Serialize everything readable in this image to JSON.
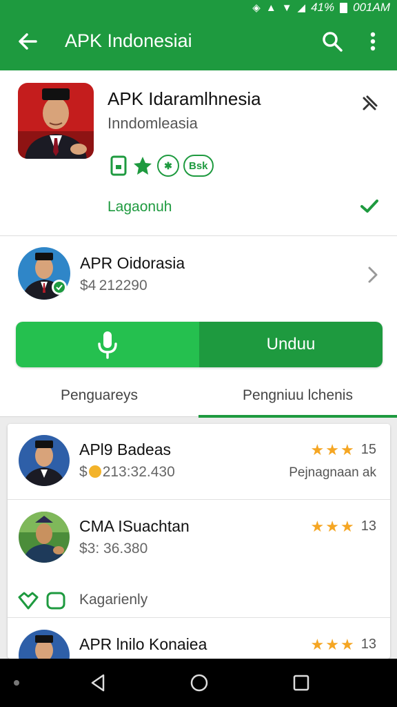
{
  "status_bar": {
    "battery_text": "41%",
    "time": "001AM"
  },
  "app_bar": {
    "title": "APK Indonesiai",
    "back_icon": "arrow-left-icon",
    "search_icon": "search-icon",
    "more_icon": "more-vert-icon"
  },
  "app_header": {
    "name": "APK Idaramlhnesia",
    "developer": "Inndomleasia",
    "badge_label": "Bsk",
    "status_label": "Lagaonuh"
  },
  "developer_row": {
    "name": "APR Oidorasia",
    "price": "$4 212290"
  },
  "action": {
    "download_label": "Unduu"
  },
  "tabs": [
    {
      "label": "Penguareys"
    },
    {
      "label": "Pengniuu lchenis"
    }
  ],
  "list": [
    {
      "title": "APl9 Badeas",
      "price": "213:32.430",
      "rating": 3,
      "count": "15",
      "subtitle": "Pejnagnaan ak"
    },
    {
      "title": "CMA ISuachtan",
      "price": "$3: 36.380",
      "rating": 3,
      "count": "13",
      "badge_label": "Kagarienly"
    },
    {
      "title": "APR lnilo Konaiea",
      "rating": 3,
      "count": "13"
    }
  ],
  "colors": {
    "primary": "#1e9a3f",
    "accent": "#25c04f",
    "star": "#f5a623"
  }
}
